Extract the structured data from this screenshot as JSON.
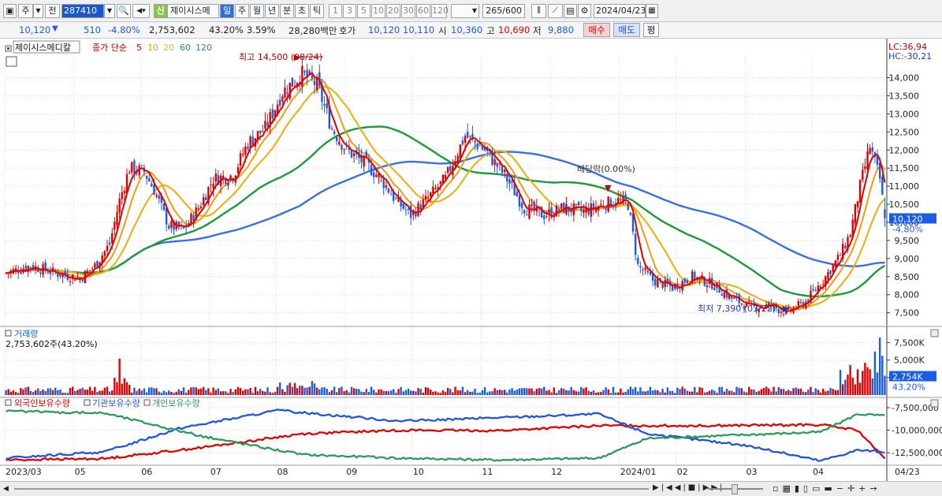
{
  "toolbar": {
    "mode_label": "주",
    "compare_label": "전",
    "stock_code": "287410",
    "new_badge": "신",
    "stock_name": "제이시스메",
    "period_tabs": [
      "일",
      "주",
      "월",
      "년",
      "분",
      "초",
      "틱"
    ],
    "interval_options": [
      "1",
      "3",
      "5",
      "10",
      "20",
      "30",
      "60",
      "120"
    ],
    "count_display": "265",
    "count_max": "/600",
    "date_value": "2024/04/23"
  },
  "quote": {
    "price": "10,120",
    "change": "510",
    "change_pct": "-4.80%",
    "volume": "2,753,602",
    "volume_ratio": "43.20%",
    "turnover_ratio": "3.59%",
    "amount": "28,280백만",
    "ask_label": "호가",
    "ask": "10,120",
    "bid": "10,110",
    "open_label": "시",
    "open": "10,360",
    "high_label": "고",
    "high": "10,690",
    "low_label": "저",
    "low": "9,880",
    "buy_label": "매수",
    "sell_label": "매도",
    "eval_label": "평"
  },
  "legend": {
    "stock_name": "제이시스메디칼",
    "ma_title": "종가 단순",
    "ma_periods": [
      "5",
      "10",
      "20",
      "60",
      "120"
    ]
  },
  "annotations": {
    "high_label": "최고 14,500 (08/24)",
    "low_label": "최저 7,390 (03/22)",
    "dividend_label": "배당락(0.00%)"
  },
  "volume_panel": {
    "title": "거래량",
    "value": "2,753,602주(43.20%)",
    "current_tag": "2,754K",
    "current_pct": "43.20%"
  },
  "holdings_panel": {
    "series_labels": [
      "외국인보유수량",
      "기관보유수량",
      "개인보유수량"
    ]
  },
  "price_tags": {
    "current": "10,120",
    "pct": "-4.80%",
    "lc": "LC:36,94",
    "hc": "HC:-30,21"
  },
  "colors": {
    "up": "#e00000",
    "down": "#1a5ce6",
    "ma5": "#e00000",
    "ma10": "#f39c12",
    "ma20": "#e6b422",
    "ma60": "#1f9a3a",
    "ma120": "#3a6fe0",
    "foreign": "#e00000",
    "institution": "#2255dd",
    "individual": "#2e9a5a"
  },
  "chart_data": [
    {
      "type": "candlestick",
      "title": "제이시스메디칼",
      "x_labels": [
        "2023/03",
        "05",
        "06",
        "07",
        "08",
        "09",
        "10",
        "11",
        "12",
        "2024/01",
        "02",
        "03",
        "04",
        "04/23"
      ],
      "y_ticks": [
        7500,
        8000,
        8500,
        9000,
        9500,
        10000,
        10500,
        11000,
        11500,
        12000,
        12500,
        13000,
        13500,
        14000
      ],
      "ylim": [
        7100,
        14600
      ],
      "close_waypoints": [
        [
          0,
          8600
        ],
        [
          10,
          8800
        ],
        [
          20,
          8600
        ],
        [
          30,
          8450
        ],
        [
          36,
          8800
        ],
        [
          42,
          9400
        ],
        [
          46,
          10600
        ],
        [
          50,
          11500
        ],
        [
          56,
          11400
        ],
        [
          60,
          10900
        ],
        [
          66,
          9900
        ],
        [
          72,
          9800
        ],
        [
          78,
          10400
        ],
        [
          84,
          11200
        ],
        [
          92,
          11300
        ],
        [
          98,
          12200
        ],
        [
          105,
          12600
        ],
        [
          112,
          13600
        ],
        [
          120,
          14100
        ],
        [
          126,
          13800
        ],
        [
          132,
          12600
        ],
        [
          138,
          12000
        ],
        [
          146,
          11600
        ],
        [
          152,
          11200
        ],
        [
          158,
          10600
        ],
        [
          164,
          10200
        ],
        [
          170,
          10600
        ],
        [
          178,
          11200
        ],
        [
          186,
          12400
        ],
        [
          194,
          12000
        ],
        [
          202,
          11300
        ],
        [
          210,
          10400
        ],
        [
          218,
          10200
        ],
        [
          226,
          10400
        ],
        [
          234,
          10300
        ],
        [
          242,
          10500
        ],
        [
          248,
          10600
        ],
        [
          252,
          10500
        ],
        [
          256,
          8800
        ],
        [
          262,
          8400
        ],
        [
          270,
          8200
        ],
        [
          278,
          8500
        ],
        [
          286,
          8300
        ],
        [
          294,
          7900
        ],
        [
          302,
          7650
        ],
        [
          310,
          7700
        ],
        [
          316,
          7500
        ],
        [
          324,
          7800
        ],
        [
          332,
          8500
        ],
        [
          338,
          9100
        ],
        [
          342,
          9700
        ],
        [
          346,
          11000
        ],
        [
          350,
          12100
        ],
        [
          354,
          11200
        ],
        [
          356,
          10120
        ]
      ],
      "ma_series": [
        {
          "name": "5",
          "color": "#e00000"
        },
        {
          "name": "10",
          "color": "#f39c12"
        },
        {
          "name": "20",
          "color": "#e6b422"
        },
        {
          "name": "60",
          "color": "#1f9a3a"
        },
        {
          "name": "120",
          "color": "#3a6fe0"
        }
      ],
      "high_marker": {
        "value": 14500,
        "date": "08/24"
      },
      "low_marker": {
        "value": 7390,
        "date": "03/22"
      }
    },
    {
      "type": "bar",
      "title": "거래량",
      "y_ticks": [
        "7,500K",
        "5,000K",
        "2,500K"
      ],
      "ylim": [
        0,
        9000
      ],
      "last_value": 2753602
    },
    {
      "type": "line",
      "y_ticks": [
        "-7,500,000",
        "-10,000,000",
        "-12,500,000"
      ],
      "ylim": [
        -13800000,
        -6800000
      ],
      "series": [
        {
          "name": "외국인보유수량",
          "color": "#e00000",
          "waypoints": [
            [
              0,
              -13300000
            ],
            [
              40,
              -13150000
            ],
            [
              80,
              -11900000
            ],
            [
              120,
              -10400000
            ],
            [
              160,
              -10000000
            ],
            [
              200,
              -10050000
            ],
            [
              240,
              -9500000
            ],
            [
              280,
              -9500000
            ],
            [
              330,
              -9400000
            ],
            [
              345,
              -10000000
            ],
            [
              356,
              -13200000
            ]
          ]
        },
        {
          "name": "기관보유수량",
          "color": "#2255dd",
          "waypoints": [
            [
              0,
              -13100000
            ],
            [
              40,
              -12400000
            ],
            [
              70,
              -9800000
            ],
            [
              110,
              -7800000
            ],
            [
              160,
              -9000000
            ],
            [
              240,
              -8200000
            ],
            [
              260,
              -10400000
            ],
            [
              300,
              -11700000
            ],
            [
              330,
              -13400000
            ],
            [
              345,
              -12200000
            ],
            [
              356,
              -12400000
            ]
          ]
        },
        {
          "name": "개인보유수량",
          "color": "#2e9a5a",
          "waypoints": [
            [
              0,
              -7900000
            ],
            [
              40,
              -8100000
            ],
            [
              80,
              -10700000
            ],
            [
              120,
              -12700000
            ],
            [
              160,
              -13100000
            ],
            [
              200,
              -13300000
            ],
            [
              240,
              -13100000
            ],
            [
              260,
              -10900000
            ],
            [
              300,
              -10500000
            ],
            [
              330,
              -10200000
            ],
            [
              345,
              -8200000
            ],
            [
              356,
              -8400000
            ]
          ]
        }
      ]
    }
  ]
}
